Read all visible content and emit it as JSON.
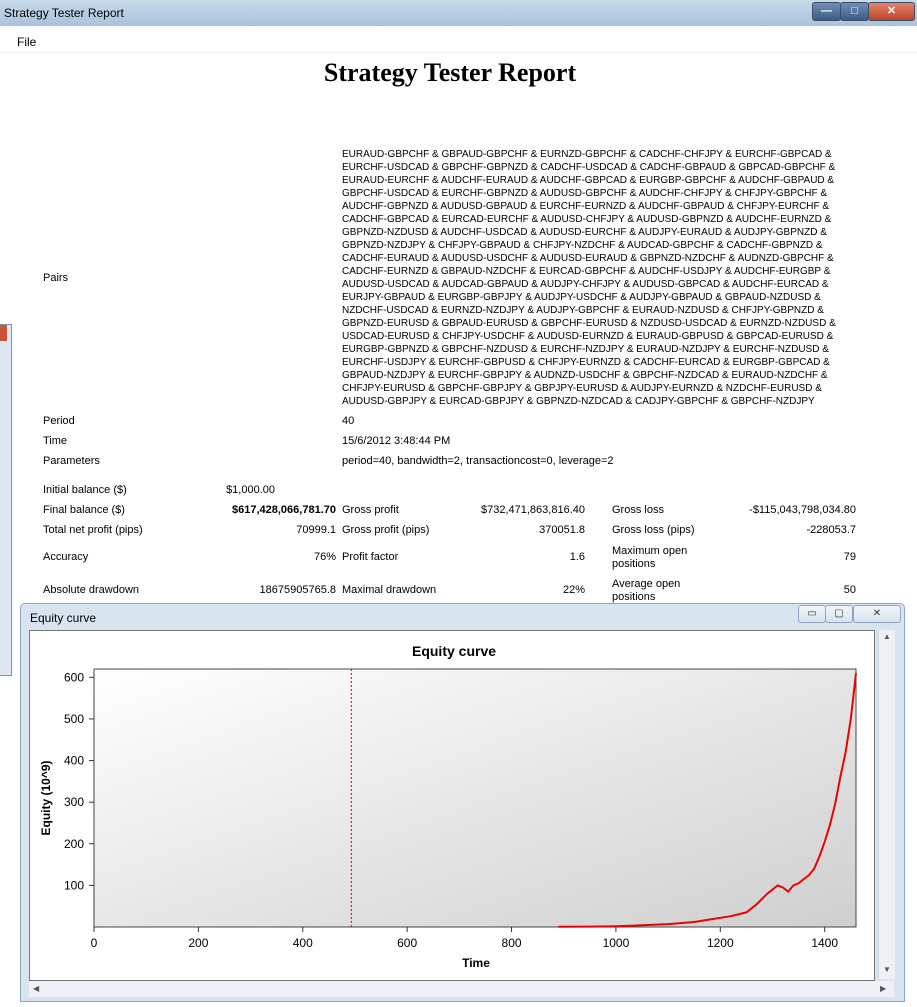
{
  "window": {
    "title": "Strategy Tester Report",
    "menu_file": "File"
  },
  "report": {
    "title": "Strategy Tester Report",
    "pairs_label": "Pairs",
    "pairs_lines": [
      "EURAUD-GBPCHF & GBPAUD-GBPCHF & EURNZD-GBPCHF & CADCHF-CHFJPY & EURCHF-GBPCAD &",
      "EURCHF-USDCAD & GBPCHF-GBPNZD & CADCHF-USDCAD & CADCHF-GBPAUD & GBPCAD-GBPCHF &",
      "EURAUD-EURCHF & AUDCHF-EURAUD & AUDCHF-GBPCAD & EURGBP-GBPCHF & AUDCHF-GBPAUD &",
      "GBPCHF-USDCAD & EURCHF-GBPNZD & AUDUSD-GBPCHF & AUDCHF-CHFJPY & CHFJPY-GBPCHF &",
      "AUDCHF-GBPNZD & AUDUSD-GBPAUD & EURCHF-EURNZD & AUDCHF-GBPAUD & CHFJPY-EURCHF &",
      "CADCHF-GBPCAD & EURCAD-EURCHF & AUDUSD-CHFJPY & AUDUSD-GBPNZD & AUDCHF-EURNZD &",
      "GBPNZD-NZDUSD & AUDCHF-USDCAD & AUDUSD-EURCHF & AUDJPY-EURAUD & AUDJPY-GBPNZD &",
      "GBPNZD-NZDJPY & CHFJPY-GBPAUD & CHFJPY-NZDCHF & AUDCAD-GBPCHF & CADCHF-GBPNZD &",
      "CADCHF-EURAUD & AUDUSD-USDCHF & AUDUSD-EURAUD & GBPNZD-NZDCHF & AUDNZD-GBPCHF &",
      "CADCHF-EURNZD & GBPAUD-NZDCHF & EURCAD-GBPCHF & AUDCHF-USDJPY & AUDCHF-EURGBP &",
      "AUDUSD-USDCAD & AUDCAD-GBPAUD & AUDJPY-CHFJPY & AUDUSD-GBPCAD & AUDCHF-EURCAD &",
      "EURJPY-GBPAUD & EURGBP-GBPJPY & AUDJPY-USDCHF & AUDJPY-GBPAUD & GBPAUD-NZDUSD &",
      "NZDCHF-USDCAD & EURNZD-NZDJPY & AUDJPY-GBPCHF & EURAUD-NZDUSD & CHFJPY-GBPNZD &",
      "GBPNZD-EURUSD & GBPAUD-EURUSD & GBPCHF-EURUSD & NZDUSD-USDCAD & EURNZD-NZDUSD &",
      "USDCAD-EURUSD & CHFJPY-USDCHF & AUDUSD-EURNZD & EURAUD-GBPUSD & GBPCAD-EURUSD &",
      "EURGBP-GBPNZD & GBPCHF-NZDUSD & EURCHF-NZDJPY & EURAUD-NZDJPY & EURCHF-NZDUSD &",
      "EURCHF-USDJPY & EURCHF-GBPUSD & CHFJPY-EURNZD & CADCHF-EURCAD & EURGBP-GBPCAD &",
      "GBPAUD-NZDJPY & EURCHF-GBPJPY & AUDNZD-USDCHF & GBPCHF-NZDCAD & EURAUD-NZDCHF &",
      "CHFJPY-EURUSD & GBPCHF-GBPJPY & GBPJPY-EURUSD & AUDJPY-EURNZD & NZDCHF-EURUSD &",
      "AUDUSD-GBPJPY & EURCAD-GBPJPY & GBPNZD-NZDCAD & CADJPY-GBPCHF & GBPCHF-NZDJPY"
    ],
    "period_label": "Period",
    "period_value": "40",
    "time_label": "Time",
    "time_value": "15/6/2012 3:48:44 PM",
    "params_label": "Parameters",
    "params_value": "period=40, bandwidth=2, transactioncost=0, leverage=2",
    "stats": {
      "initial_balance_label": "Initial balance ($)",
      "initial_balance": "$1,000.00",
      "final_balance_label": "Final balance ($)",
      "final_balance": "$617,428,066,781.70",
      "gross_profit_label": "Gross profit",
      "gross_profit": "$732,471,863,816.40",
      "gross_loss_label": "Gross loss",
      "gross_loss": "-$115,043,798,034.80",
      "net_profit_label": "Total net profit (pips)",
      "net_profit": "70999.1",
      "gross_profit_pips_label": "Gross profit (pips)",
      "gross_profit_pips": "370051.8",
      "gross_loss_pips_label": "Gross loss (pips)",
      "gross_loss_pips": "-228053.7",
      "accuracy_label": "Accuracy",
      "accuracy": "76%",
      "profit_factor_label": "Profit factor",
      "profit_factor": "1.6",
      "max_open_label_1": "Maximum open",
      "max_open_label_2": "positions",
      "max_open": "79",
      "abs_drawdown_label": "Absolute drawdown",
      "abs_drawdown": "18675905765.8",
      "max_drawdown_label": "Maximal drawdown",
      "max_drawdown": "22%",
      "avg_open_label_1": "Average open",
      "avg_open_label_2": "positions",
      "avg_open": "50"
    }
  },
  "equity_window": {
    "title": "Equity curve",
    "min_glyph": "▭",
    "max_glyph": "▢",
    "close_glyph": "✕"
  },
  "chart_data": {
    "type": "line",
    "title": "Equity curve",
    "xlabel": "Time",
    "ylabel": "Equity (10^9)",
    "xlim": [
      0,
      1460
    ],
    "ylim": [
      0,
      620
    ],
    "xticks": [
      0,
      200,
      400,
      600,
      800,
      1000,
      1200,
      1400
    ],
    "yticks": [
      100,
      200,
      300,
      400,
      500,
      600
    ],
    "vline_x": 493,
    "vline_color": "#cc0000",
    "line_color": "#ee0000",
    "series": [
      {
        "x": [
          890,
          950,
          1000,
          1050,
          1100,
          1150,
          1180,
          1200,
          1220,
          1250,
          1270,
          1290,
          1310,
          1320,
          1330,
          1340,
          1350,
          1360,
          1370,
          1380,
          1390,
          1400,
          1410,
          1420,
          1430,
          1440,
          1450,
          1460
        ],
        "y": [
          0.5,
          1,
          2,
          4,
          7,
          12,
          18,
          22,
          26,
          35,
          55,
          80,
          100,
          95,
          85,
          100,
          105,
          115,
          125,
          140,
          170,
          205,
          245,
          295,
          360,
          420,
          500,
          610
        ]
      }
    ]
  }
}
